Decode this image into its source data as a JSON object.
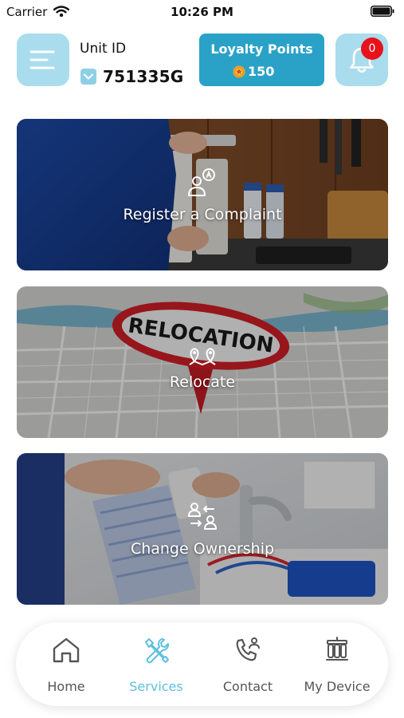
{
  "status_bar": {
    "carrier": "Carrier",
    "time": "10:26 PM",
    "wifi_icon": "wifi-icon",
    "battery_icon": "battery-icon"
  },
  "header": {
    "menu_icon": "menu-icon",
    "unit_label": "Unit ID",
    "unit_value": "751335G",
    "loyalty": {
      "title": "Loyalty Points",
      "value": "150",
      "icon": "coin-icon"
    },
    "notifications": {
      "icon": "bell-icon",
      "count": "0"
    }
  },
  "services": [
    {
      "label": "Register a Complaint",
      "icon": "complaint-user-icon"
    },
    {
      "label": "Relocate",
      "icon": "location-pins-icon",
      "image_text": "RELOCATION"
    },
    {
      "label": "Change Ownership",
      "icon": "transfer-users-icon"
    }
  ],
  "bottom_nav": {
    "items": [
      {
        "label": "Home",
        "icon": "home-icon"
      },
      {
        "label": "Services",
        "icon": "tools-icon",
        "active": true
      },
      {
        "label": "Contact",
        "icon": "phone-icon"
      },
      {
        "label": "My Device",
        "icon": "water-filter-icon"
      }
    ]
  },
  "colors": {
    "accent": "#2aa2c8",
    "accent_light": "#a9dced",
    "badge": "#e8121b",
    "nav_active": "#5cc0df",
    "nav_inactive": "#555555"
  }
}
